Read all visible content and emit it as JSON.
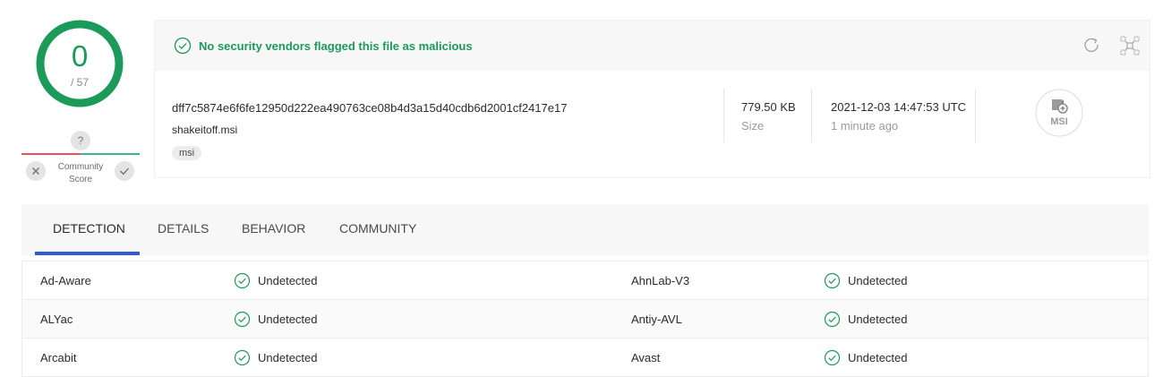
{
  "score": {
    "detections": "0",
    "total": "/ 57",
    "color": "#1c9a5a"
  },
  "community": {
    "badge": "?",
    "label": "Community Score",
    "dislike_icon": "close-icon",
    "like_icon": "check-icon"
  },
  "banner": {
    "message": "No security vendors flagged this file as malicious",
    "reanalyze_icon": "reload-icon",
    "graph_icon": "graph-icon"
  },
  "file": {
    "hash": "dff7c5874e6f6fe12950d222ea490763ce08b4d3a15d40cdb6d2001cf2417e17",
    "name": "shakeitoff.msi",
    "tag": "msi",
    "size": "779.50 KB",
    "size_label": "Size",
    "date": "2021-12-03 14:47:53 UTC",
    "date_relative": "1 minute ago",
    "type_icon_label": "MSI"
  },
  "tabs": [
    {
      "label": "DETECTION",
      "active": true
    },
    {
      "label": "DETAILS",
      "active": false
    },
    {
      "label": "BEHAVIOR",
      "active": false
    },
    {
      "label": "COMMUNITY",
      "active": false
    }
  ],
  "detections": [
    {
      "engine_left": "Ad-Aware",
      "result_left": "Undetected",
      "engine_right": "AhnLab-V3",
      "result_right": "Undetected"
    },
    {
      "engine_left": "ALYac",
      "result_left": "Undetected",
      "engine_right": "Antiy-AVL",
      "result_right": "Undetected"
    },
    {
      "engine_left": "Arcabit",
      "result_left": "Undetected",
      "engine_right": "Avast",
      "result_right": "Undetected"
    }
  ],
  "colors": {
    "accent_green": "#1c9a5a",
    "tab_active": "#2f5bd8",
    "community_red": "#e8505b",
    "community_green": "#3db39c"
  }
}
